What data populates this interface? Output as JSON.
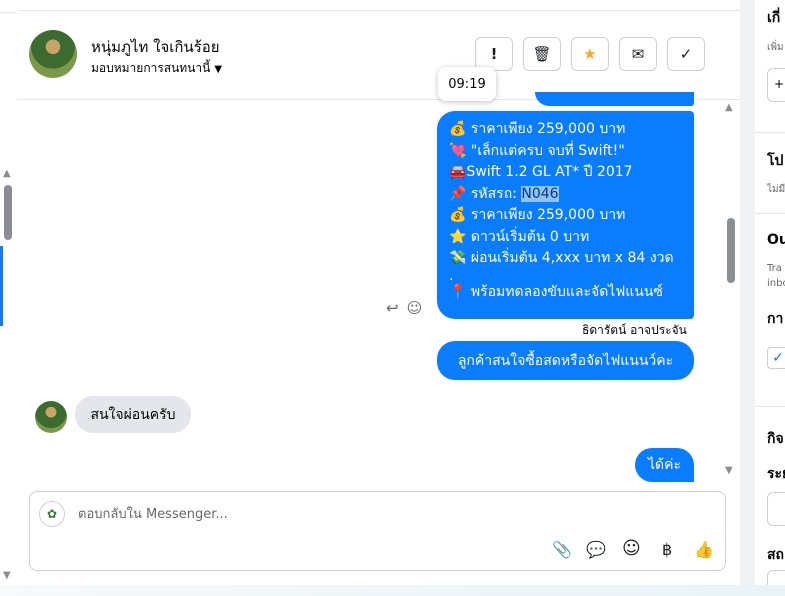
{
  "contact": {
    "name": "หนุ่มภูไท ใจเกินร้อย",
    "assign_label": "มอบหมายการสนทนานี้",
    "assign_caret": "▼"
  },
  "toolbar": {
    "spam_icon": "!",
    "delete_icon": "🗑",
    "star_icon": "★",
    "mail_icon": "✉",
    "done_icon": "✓"
  },
  "tooltip_time": "09:19",
  "messages": {
    "main_lines": [
      "💰 ราคาเพียง 259,000 บาท",
      "💘 \"เล็กแต่ครบ จบที่ Swift!\"",
      "🚘Swift 1.2 GL AT* ปี 2017",
      "📌 รหัสรถ: ",
      "💰 ราคาเพียง 259,000 บาท",
      "⭐ ดาวน์เริ่มต้น 0 บาท",
      "💸 ผ่อนเริ่มต้น 4,xxx บาท x 84 งวด",
      ".",
      "📍 พร้อมทดลองขับและจัดไฟแนนซ์"
    ],
    "code_highlight": "N046",
    "sender_name": "ธิดารัตน์ อาจประจัน",
    "reply_out": "ลูกค้าสนใจซื้อสดหรือจัดไฟแนนว์คะ",
    "incoming": "สนใจผ่อนครับ",
    "reply_last": "ได้ค่ะ",
    "react_reply_icon": "↩",
    "react_emoji_icon": "☺"
  },
  "composer": {
    "placeholder": "ตอบกลับใน Messenger...",
    "attach_icon": "📎",
    "saved_reply_icon": "💬",
    "emoji_icon": "☺",
    "payment_icon": "฿",
    "like_icon": "👍"
  },
  "right_panel": {
    "s1_title": "เกี่",
    "s1_sub": "เพิ่ม",
    "s2_title": "โป",
    "s2_sub": "ไม่มี",
    "s3_title": "Ou",
    "s3_sub1": "Tra",
    "s3_sub2": "inbo",
    "s3_label": "กา",
    "s4_title": "กิจ",
    "s4_label": "ระย",
    "s4_label2": "สถ"
  }
}
